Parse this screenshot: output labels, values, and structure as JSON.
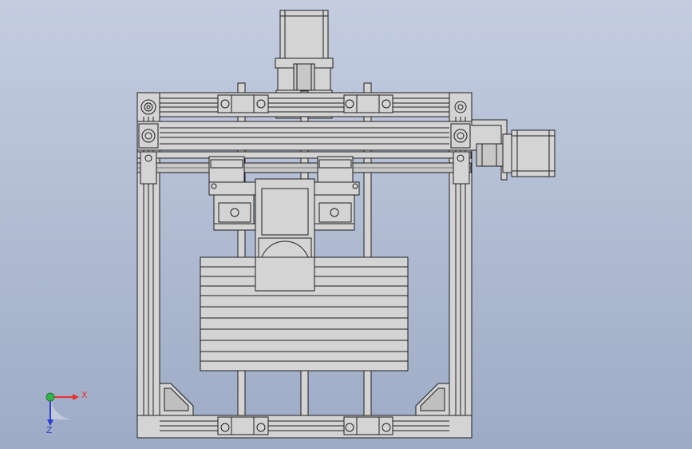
{
  "scene": {
    "background_top": "#c4cde0",
    "background_bottom": "#9eabc6",
    "part_fill": "#d4d4d4",
    "part_dark": "#a8a8a8",
    "edge_color": "#1e1e1e"
  },
  "triad": {
    "x_label": "X",
    "z_label": "Z",
    "x_color": "#e8322d",
    "y_color": "#2fb44a",
    "z_color": "#2c3fd2"
  }
}
